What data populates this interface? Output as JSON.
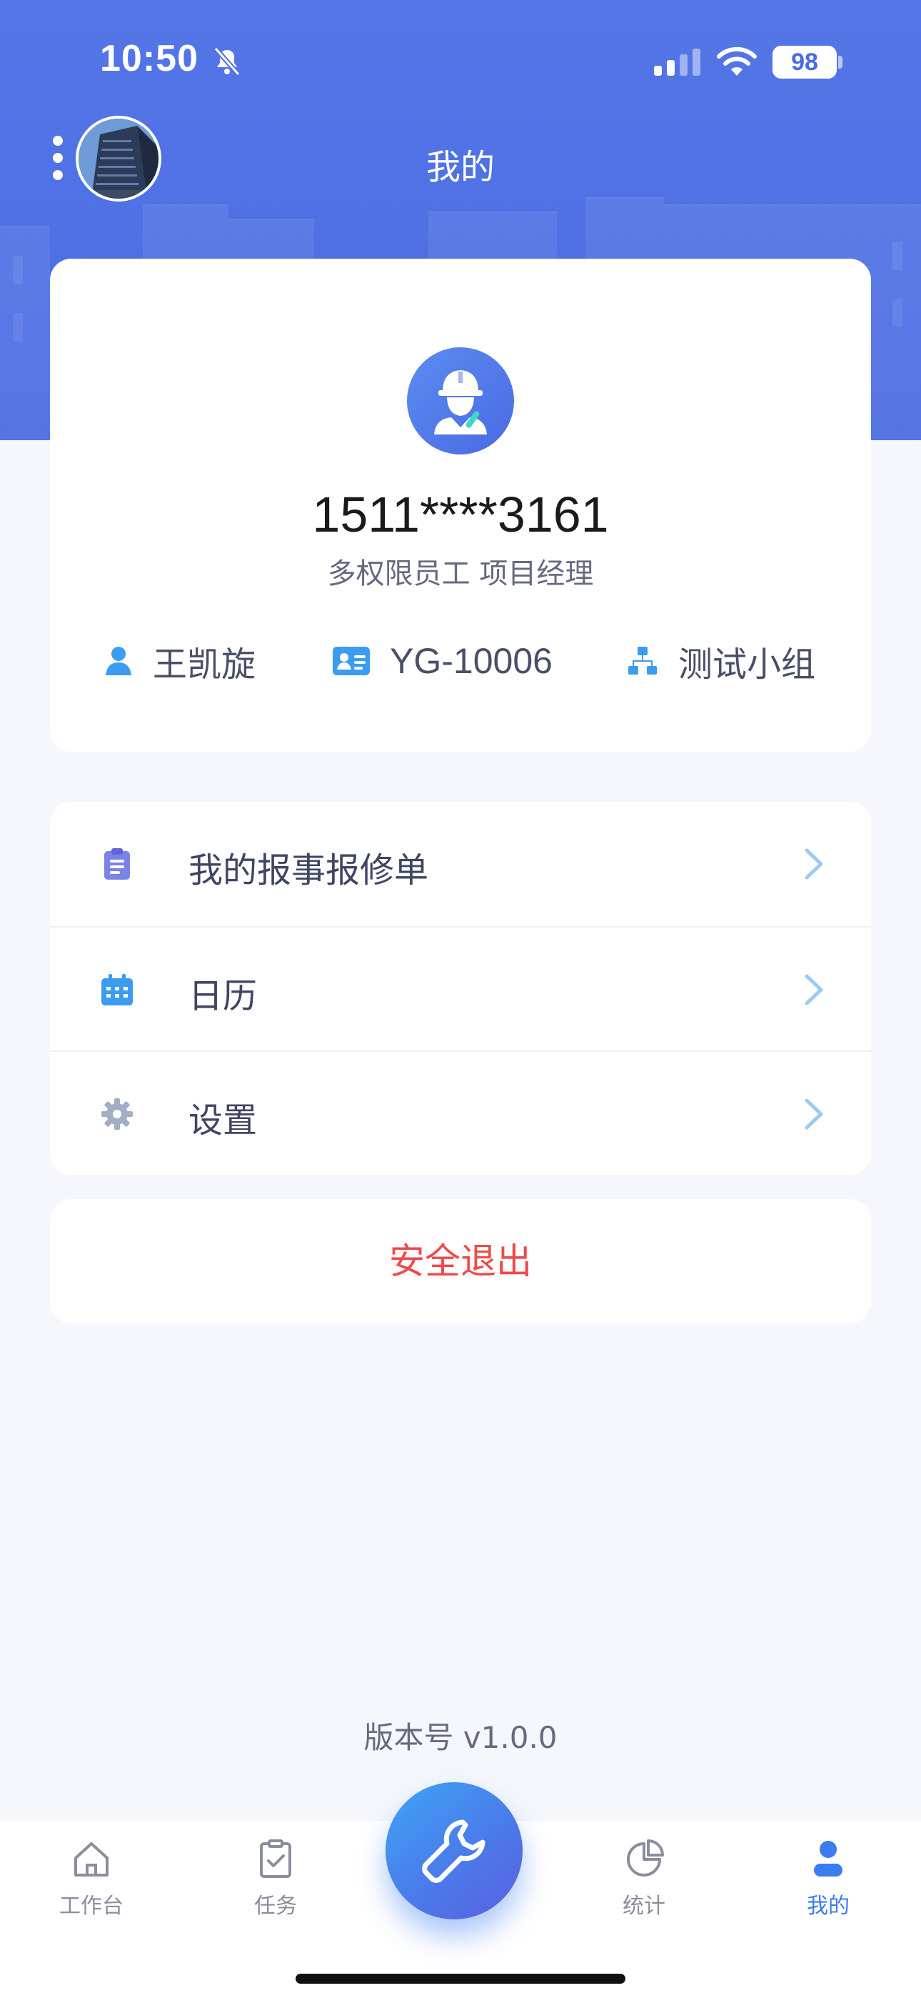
{
  "status_bar": {
    "time": "10:50",
    "battery": "98"
  },
  "nav": {
    "title": "我的"
  },
  "profile": {
    "phone": "1511****3161",
    "role": "多权限员工 项目经理",
    "name": "王凯旋",
    "employee_id": "YG-10006",
    "group": "测试小组"
  },
  "menu": {
    "items": [
      {
        "label": "我的报事报修单",
        "icon": "clipboard-icon"
      },
      {
        "label": "日历",
        "icon": "calendar-icon"
      },
      {
        "label": "设置",
        "icon": "gear-icon"
      }
    ]
  },
  "logout_label": "安全退出",
  "version": "版本号 v1.0.0",
  "tabs": [
    {
      "label": "工作台",
      "icon": "home-icon"
    },
    {
      "label": "任务",
      "icon": "clipboard-check-icon"
    },
    {
      "label": "统计",
      "icon": "pie-chart-icon"
    },
    {
      "label": "我的",
      "icon": "person-icon",
      "active": true
    }
  ],
  "colors": {
    "header": "#4f70e4",
    "accent": "#3b7cf0",
    "logout": "#ee4a4a",
    "background": "#f5f7fc"
  }
}
